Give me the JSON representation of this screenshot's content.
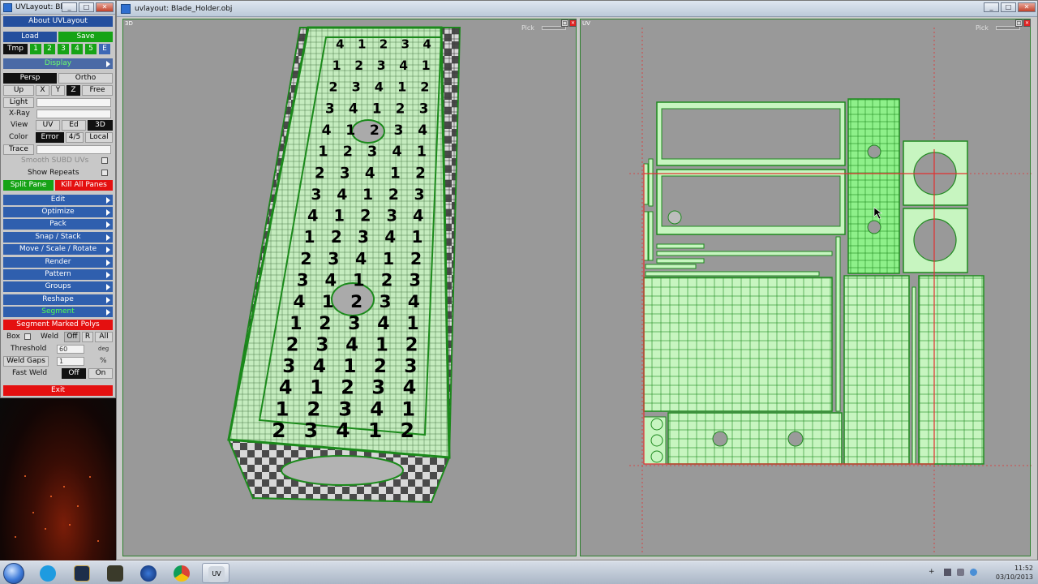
{
  "toolwin": {
    "title": "UVLayout: Bl...",
    "about": "About UVLayout",
    "load": "Load",
    "save": "Save",
    "tmp": "Tmp",
    "tmp_slots": [
      "1",
      "2",
      "3",
      "4",
      "5",
      "E"
    ],
    "display": "Display",
    "persp": "Persp",
    "ortho": "Ortho",
    "up": "Up",
    "axes": [
      "X",
      "Y",
      "Z"
    ],
    "free": "Free",
    "light": "Light",
    "xray": "X-Ray",
    "view": "View",
    "view_opts": [
      "UV",
      "Ed",
      "3D"
    ],
    "color": "Color",
    "color_opts": [
      "Error",
      "4/5",
      "Local"
    ],
    "trace": "Trace",
    "smooth": "Smooth SUBD UVs",
    "show_repeats": "Show Repeats",
    "split_pane": "Split Pane",
    "kill_all": "Kill All Panes",
    "menus": [
      "Edit",
      "Optimize",
      "Pack",
      "Snap / Stack",
      "Move / Scale / Rotate",
      "Render",
      "Pattern",
      "Groups",
      "Reshape",
      "Segment"
    ],
    "segment_marked": "Segment Marked Polys",
    "box": "Box",
    "weld": "Weld",
    "weld_opts": [
      "Off",
      "R",
      "All"
    ],
    "threshold": "Threshold",
    "threshold_val": "60",
    "threshold_unit": "deg",
    "weld_gaps": "Weld Gaps",
    "weld_gaps_val": "1",
    "weld_gaps_unit": "%",
    "fast_weld": "Fast Weld",
    "fast_opts": [
      "Off",
      "On"
    ],
    "exit": "Exit"
  },
  "mainwin": {
    "title": "uvlayout: Blade_Holder.obj",
    "pane3d_tag": "3D",
    "paneuv_tag": "UV",
    "pick": "Pick"
  },
  "taskbar": {
    "time": "11:52",
    "date": "03/10/2013"
  },
  "colors": {
    "uv_fill": "#c7f5c0",
    "uv_edge": "#1f8a1f",
    "uv_bright": "#8ef08a",
    "grid_red": "#e23030",
    "viewport_bg": "#999999"
  },
  "cube_numbers": [
    [
      "4",
      "1",
      "2",
      "3",
      "4"
    ],
    [
      "1",
      "2",
      "3",
      "4",
      "1"
    ],
    [
      "2",
      "3",
      "4",
      "1",
      "2"
    ],
    [
      "3",
      "4",
      "1",
      "2",
      "3"
    ]
  ]
}
